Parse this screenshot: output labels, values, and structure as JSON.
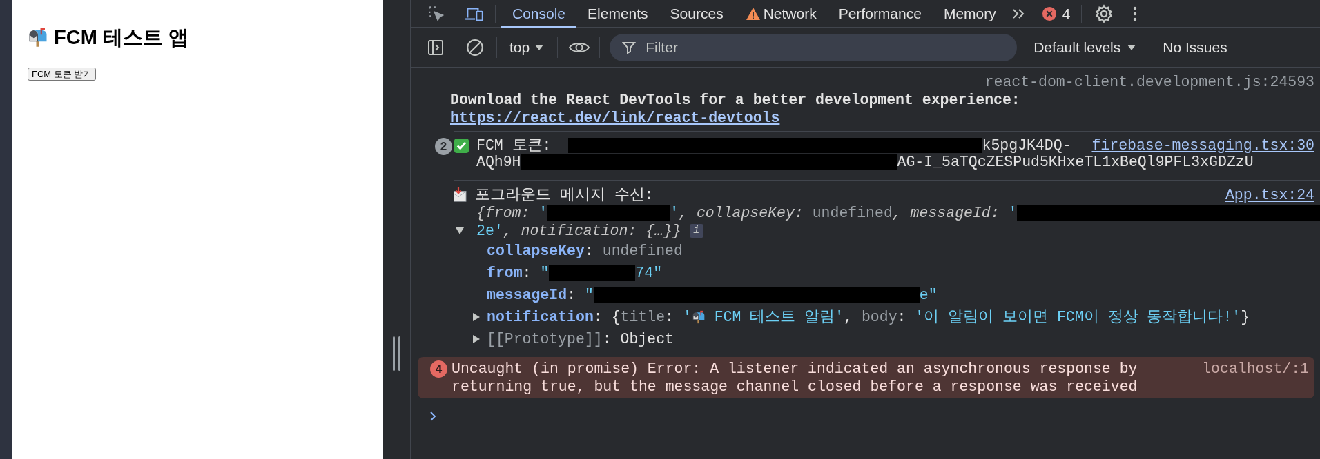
{
  "app": {
    "title": "FCM 테스트 앱",
    "button": "FCM 토큰 받기"
  },
  "devtools": {
    "tabs": [
      {
        "label": "Console",
        "selected": true
      },
      {
        "label": "Elements",
        "selected": false
      },
      {
        "label": "Sources",
        "selected": false
      },
      {
        "label": "Network",
        "selected": false,
        "kind": "warning"
      },
      {
        "label": "Performance",
        "selected": false
      },
      {
        "label": "Memory",
        "selected": false
      }
    ],
    "error_count": "4",
    "context": "top",
    "filter": {
      "placeholder": "Filter"
    },
    "levels": "Default levels",
    "issues": "No Issues"
  },
  "console": {
    "messages": [
      {
        "kind": "hint",
        "source": "react-dom-client.development.js:24593",
        "text": "Download the React DevTools for a better development experience:",
        "link": "https://react.dev/link/react-devtools"
      },
      {
        "kind": "token",
        "repeat": "2",
        "source": "firebase-messaging.tsx:30",
        "lines": [
          [
            {
              "kind": "plain",
              "text": "FCM 토큰:"
            },
            {
              "kind": "redacted"
            },
            {
              "kind": "plain",
              "text": "k5pgJK4DQ-"
            }
          ],
          [
            {
              "kind": "plain",
              "text": "AQh9H"
            },
            {
              "kind": "redacted"
            },
            {
              "kind": "plain",
              "text": "AG-I_5aTQcZESPud5KHxeTL1xBeQl9PFL3xGDZzU"
            }
          ]
        ]
      },
      {
        "kind": "object",
        "label": "포그라운드 메시지 수신:",
        "source": "App.tsx:24",
        "expanded": true,
        "preview": [
          [
            {
              "kind": "pkey",
              "text": "{from: "
            },
            {
              "kind": "string",
              "text": "'"
            },
            {
              "kind": "redacted"
            },
            {
              "kind": "string",
              "text": "'"
            },
            {
              "kind": "pkey",
              "text": ", collapseKey: "
            },
            {
              "kind": "undef",
              "text": "undefined"
            },
            {
              "kind": "pkey",
              "text": ", messageId: "
            },
            {
              "kind": "string",
              "text": "'"
            },
            {
              "kind": "redacted"
            }
          ],
          [
            {
              "kind": "string",
              "text": "2e'"
            },
            {
              "kind": "pkey",
              "text": ", notification: {…}}"
            },
            {
              "kind": "info",
              "text": "i"
            }
          ]
        ],
        "properties": [
          {
            "segments": [
              {
                "kind": "key",
                "text": "collapseKey"
              },
              {
                "kind": "punct",
                "text": ": "
              },
              {
                "kind": "undef",
                "text": "undefined"
              }
            ]
          },
          {
            "segments": [
              {
                "kind": "key",
                "text": "from"
              },
              {
                "kind": "punct",
                "text": ": "
              },
              {
                "kind": "string",
                "text": "\""
              },
              {
                "kind": "redacted"
              },
              {
                "kind": "string",
                "text": "74\""
              }
            ]
          },
          {
            "segments": [
              {
                "kind": "key",
                "text": "messageId"
              },
              {
                "kind": "punct",
                "text": ": "
              },
              {
                "kind": "string",
                "text": "\""
              },
              {
                "kind": "redacted"
              },
              {
                "kind": "string",
                "text": "e\""
              }
            ]
          },
          {
            "expanded": false,
            "segments": [
              {
                "kind": "key",
                "text": "notification"
              },
              {
                "kind": "punct",
                "text": ": {"
              },
              {
                "kind": "undef",
                "text": "title"
              },
              {
                "kind": "punct",
                "text": ": "
              },
              {
                "kind": "string",
                "text": "'"
              },
              {
                "kind": "mailbox"
              },
              {
                "kind": "string",
                "text": " FCM 테스트 알림'"
              },
              {
                "kind": "punct",
                "text": ", "
              },
              {
                "kind": "undef",
                "text": "body"
              },
              {
                "kind": "punct",
                "text": ": "
              },
              {
                "kind": "string",
                "text": "'이 알림이 보이면 FCM이 정상 동작합니다!'"
              },
              {
                "kind": "punct",
                "text": "}"
              }
            ]
          },
          {
            "expanded": false,
            "segments": [
              {
                "kind": "undef",
                "text": "[[Prototype]]"
              },
              {
                "kind": "punct",
                "text": ": Object"
              }
            ]
          }
        ]
      },
      {
        "kind": "error",
        "repeat": "4",
        "source": "localhost/:1",
        "text": "Uncaught (in promise) Error: A listener indicated an asynchronous response by returning true, but the message channel closed before a response was received"
      }
    ]
  }
}
